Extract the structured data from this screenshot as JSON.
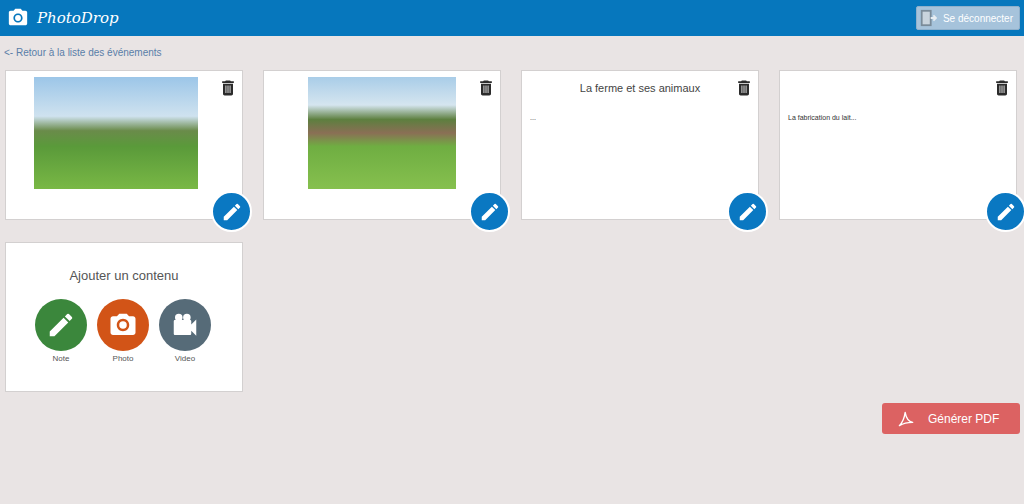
{
  "header": {
    "logo": "PhotoDrop",
    "logout": "Se déconnecter"
  },
  "back_link": "<- Retour à la liste des événements",
  "contents": [
    {
      "kind": "photo"
    },
    {
      "kind": "photo"
    },
    {
      "kind": "note",
      "title": "La ferme et ses animaux",
      "text": "..."
    },
    {
      "kind": "note",
      "text": "La fabrication du lait..."
    }
  ],
  "add": {
    "title": "Ajouter un contenu",
    "options": [
      {
        "kind": "note",
        "label": "Note",
        "color": "#3b873c"
      },
      {
        "kind": "photo",
        "label": "Photo",
        "color": "#d25417"
      },
      {
        "kind": "video",
        "label": "Video",
        "color": "#566b78"
      }
    ]
  },
  "pdf_button": "Générer PDF"
}
